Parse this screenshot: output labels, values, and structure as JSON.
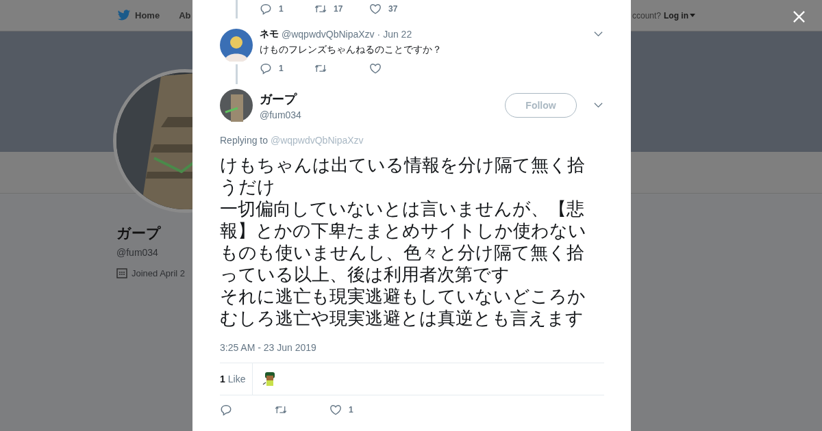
{
  "topnav": {
    "home": "Home",
    "about": "Ab",
    "account_prompt": "ccount?",
    "login": "Log in"
  },
  "profile": {
    "name": "ガープ",
    "handle": "@fum034",
    "joined": "Joined April 2"
  },
  "parent_actions": {
    "replies": "1",
    "retweets": "17",
    "likes": "37"
  },
  "reply_tweet": {
    "name": "ネモ",
    "handle": "@wqpwdvQbNipaXzv",
    "date": "· Jun 22",
    "text": "けものフレンズちゃんねるのことですか？",
    "replies": "1"
  },
  "main_tweet": {
    "name": "ガープ",
    "handle": "@fum034",
    "follow": "Follow",
    "replying_label": "Replying to",
    "replying_to": "@wqpwdvQbNipaXzv",
    "paragraphs": [
      "けもちゃんは出ている情報を分け隔て無く拾うだけ",
      "一切偏向していないとは言いませんが、【悲報】とかの下卑たまとめサイトしか使わないものも使いませんし、色々と分け隔て無く拾っている以上、後は利用者次第です",
      "それに逃亡も現実逃避もしていないどころかむしろ逃亡や現実逃避とは真逆とも言えます"
    ],
    "timestamp": "3:25 AM - 23 Jun 2019",
    "like_count": "1",
    "like_label": "Like",
    "likes": "1"
  }
}
